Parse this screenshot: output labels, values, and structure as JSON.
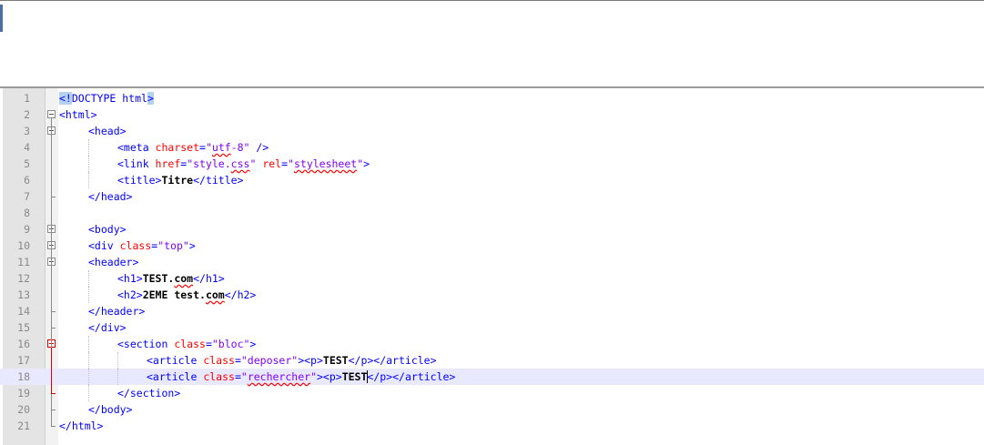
{
  "editor": {
    "lines": [
      {
        "n": "1",
        "tokens": [
          {
            "t": "<!",
            "c": "tag hl"
          },
          {
            "t": "DOCTYPE html",
            "c": "tag"
          },
          {
            "t": ">",
            "c": "tag hl"
          }
        ],
        "indent": 0
      },
      {
        "n": "2",
        "tokens": [
          {
            "t": "<html>",
            "c": "tag"
          }
        ],
        "indent": 0
      },
      {
        "n": "3",
        "tokens": [
          {
            "t": "<head>",
            "c": "tag"
          }
        ],
        "indent": 1
      },
      {
        "n": "4",
        "tokens": [
          {
            "t": "<meta ",
            "c": "tag"
          },
          {
            "t": "charset",
            "c": "attr"
          },
          {
            "t": "=",
            "c": "tag"
          },
          {
            "t": "\"",
            "c": "val"
          },
          {
            "t": "utf",
            "c": "val squig"
          },
          {
            "t": "-8\"",
            "c": "val"
          },
          {
            "t": " />",
            "c": "tag"
          }
        ],
        "indent": 2
      },
      {
        "n": "5",
        "tokens": [
          {
            "t": "<link ",
            "c": "tag"
          },
          {
            "t": "href",
            "c": "attr"
          },
          {
            "t": "=",
            "c": "tag"
          },
          {
            "t": "\"style.",
            "c": "val"
          },
          {
            "t": "css",
            "c": "val squig"
          },
          {
            "t": "\"",
            "c": "val"
          },
          {
            "t": " ",
            "c": "tag"
          },
          {
            "t": "rel",
            "c": "attr"
          },
          {
            "t": "=",
            "c": "tag"
          },
          {
            "t": "\"",
            "c": "val"
          },
          {
            "t": "stylesheet",
            "c": "val squig"
          },
          {
            "t": "\"",
            "c": "val"
          },
          {
            "t": ">",
            "c": "tag"
          }
        ],
        "indent": 2
      },
      {
        "n": "6",
        "tokens": [
          {
            "t": "<title>",
            "c": "tag"
          },
          {
            "t": "Titre",
            "c": "txt"
          },
          {
            "t": "</title>",
            "c": "tag"
          }
        ],
        "indent": 2
      },
      {
        "n": "7",
        "tokens": [
          {
            "t": "</head>",
            "c": "tag"
          }
        ],
        "indent": 1
      },
      {
        "n": "8",
        "tokens": [],
        "indent": 0
      },
      {
        "n": "9",
        "tokens": [
          {
            "t": "<body>",
            "c": "tag"
          }
        ],
        "indent": 1
      },
      {
        "n": "10",
        "tokens": [
          {
            "t": "<div ",
            "c": "tag"
          },
          {
            "t": "class",
            "c": "attr"
          },
          {
            "t": "=",
            "c": "tag"
          },
          {
            "t": "\"top\"",
            "c": "val"
          },
          {
            "t": ">",
            "c": "tag"
          }
        ],
        "indent": 1
      },
      {
        "n": "11",
        "tokens": [
          {
            "t": "<header>",
            "c": "tag"
          }
        ],
        "indent": 1
      },
      {
        "n": "12",
        "tokens": [
          {
            "t": "<h1>",
            "c": "tag"
          },
          {
            "t": "TEST.",
            "c": "txt"
          },
          {
            "t": "com",
            "c": "txt squig"
          },
          {
            "t": "</h1>",
            "c": "tag"
          }
        ],
        "indent": 2
      },
      {
        "n": "13",
        "tokens": [
          {
            "t": "<h2>",
            "c": "tag"
          },
          {
            "t": "2EME test.",
            "c": "txt"
          },
          {
            "t": "com",
            "c": "txt squig"
          },
          {
            "t": "</h2>",
            "c": "tag"
          }
        ],
        "indent": 2
      },
      {
        "n": "14",
        "tokens": [
          {
            "t": "</header>",
            "c": "tag"
          }
        ],
        "indent": 1
      },
      {
        "n": "15",
        "tokens": [
          {
            "t": "</div>",
            "c": "tag"
          }
        ],
        "indent": 1
      },
      {
        "n": "16",
        "tokens": [
          {
            "t": "<section ",
            "c": "tag"
          },
          {
            "t": "class",
            "c": "attr"
          },
          {
            "t": "=",
            "c": "tag"
          },
          {
            "t": "\"bloc\"",
            "c": "val"
          },
          {
            "t": ">",
            "c": "tag"
          }
        ],
        "indent": 2
      },
      {
        "n": "17",
        "tokens": [
          {
            "t": "<article ",
            "c": "tag"
          },
          {
            "t": "class",
            "c": "attr"
          },
          {
            "t": "=",
            "c": "tag"
          },
          {
            "t": "\"deposer\"",
            "c": "val"
          },
          {
            "t": "><p>",
            "c": "tag"
          },
          {
            "t": "TEST",
            "c": "txt"
          },
          {
            "t": "</p></article>",
            "c": "tag"
          }
        ],
        "indent": 3
      },
      {
        "n": "18",
        "tokens": [
          {
            "t": "<article ",
            "c": "tag"
          },
          {
            "t": "class",
            "c": "attr"
          },
          {
            "t": "=",
            "c": "tag"
          },
          {
            "t": "\"",
            "c": "val"
          },
          {
            "t": "rechercher",
            "c": "val squig"
          },
          {
            "t": "\"",
            "c": "val"
          },
          {
            "t": "><p>",
            "c": "tag"
          },
          {
            "t": "TEST",
            "c": "txt"
          },
          {
            "t": "</p></article>",
            "c": "tag"
          }
        ],
        "indent": 3
      },
      {
        "n": "19",
        "tokens": [
          {
            "t": "</section>",
            "c": "tag"
          }
        ],
        "indent": 2
      },
      {
        "n": "20",
        "tokens": [
          {
            "t": "</body>",
            "c": "tag"
          }
        ],
        "indent": 1
      },
      {
        "n": "21",
        "tokens": [
          {
            "t": "</html>",
            "c": "tag"
          }
        ],
        "indent": 0
      }
    ],
    "current_line": "18",
    "fold_markers": [
      {
        "line": "2",
        "type": "open",
        "color": "#8a8a8a"
      },
      {
        "line": "3",
        "type": "open",
        "color": "#8a8a8a"
      },
      {
        "line": "9",
        "type": "open",
        "color": "#8a8a8a"
      },
      {
        "line": "10",
        "type": "open",
        "color": "#8a8a8a"
      },
      {
        "line": "11",
        "type": "open",
        "color": "#8a8a8a"
      },
      {
        "line": "16",
        "type": "open",
        "color": "#e00000"
      }
    ]
  },
  "colors": {
    "tag": "#0000ff",
    "attribute": "#ff0000",
    "value": "#8000ff",
    "text": "#000000",
    "current_line_bg": "#e8e8ff",
    "gutter_bg": "#e4e4e4"
  }
}
